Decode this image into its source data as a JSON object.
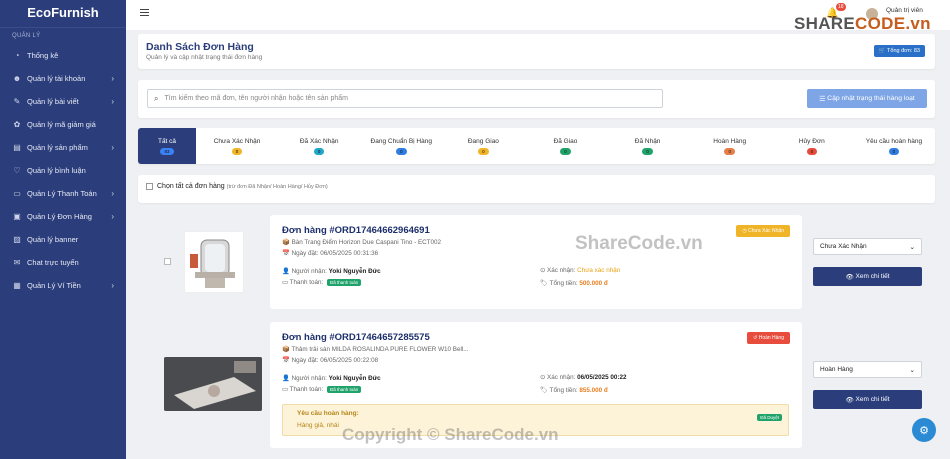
{
  "sidebar": {
    "logo": "EcoFurnish",
    "section_label": "QUẢN LÝ",
    "items": [
      {
        "label": "Thống kê",
        "icon": "gauge-icon",
        "glyph": "◔",
        "chev": ""
      },
      {
        "label": "Quản lý tài khoản",
        "icon": "user-icon",
        "glyph": "☻",
        "chev": "›"
      },
      {
        "label": "Quản lý bài viết",
        "icon": "document-icon",
        "glyph": "✎",
        "chev": "›"
      },
      {
        "label": "Quản lý mã giảm giá",
        "icon": "gift-icon",
        "glyph": "✿",
        "chev": ""
      },
      {
        "label": "Quản lý sản phẩm",
        "icon": "box-icon",
        "glyph": "▤",
        "chev": "›"
      },
      {
        "label": "Quản lý bình luận",
        "icon": "heart-icon",
        "glyph": "♡",
        "chev": ""
      },
      {
        "label": "Quản Lý Thanh Toán",
        "icon": "card-icon",
        "glyph": "▭",
        "chev": "›"
      },
      {
        "label": "Quản Lý Đơn Hàng",
        "icon": "clipboard-icon",
        "glyph": "▣",
        "chev": "›"
      },
      {
        "label": "Quản lý banner",
        "icon": "image-icon",
        "glyph": "▨",
        "chev": ""
      },
      {
        "label": "Chat trực tuyến",
        "icon": "chat-icon",
        "glyph": "✉",
        "chev": ""
      },
      {
        "label": "Quản Lý Ví Tiền",
        "icon": "wallet-icon",
        "glyph": "▦",
        "chev": "›"
      }
    ]
  },
  "topbar": {
    "user_name": "Quản trị viên",
    "notif_count": "18"
  },
  "page": {
    "title": "Danh Sách Đơn Hàng",
    "subtitle": "Quản lý và cập nhật trạng thái đơn hàng",
    "total": "Tổng đơn: 83"
  },
  "search": {
    "placeholder": "Tìm kiếm theo mã đơn, tên người nhận hoặc tên sản phẩm",
    "bulk_label": "Cập nhật trạng thái hàng loạt"
  },
  "tabs": [
    {
      "label": "Tất cả",
      "count": "83",
      "color": "#3b82f6"
    },
    {
      "label": "Chưa Xác Nhận",
      "count": "0",
      "color": "#f0b429"
    },
    {
      "label": "Đã Xác Nhận",
      "count": "0",
      "color": "#1fa7c7"
    },
    {
      "label": "Đang Chuẩn Bị Hàng",
      "count": "0",
      "color": "#2f7de1"
    },
    {
      "label": "Đang Giao",
      "count": "0",
      "color": "#f0b429"
    },
    {
      "label": "Đã Giao",
      "count": "0",
      "color": "#20a36b"
    },
    {
      "label": "Đã Nhận",
      "count": "0",
      "color": "#20a36b"
    },
    {
      "label": "Hoàn Hàng",
      "count": "0",
      "color": "#e67e4a"
    },
    {
      "label": "Hủy Đơn",
      "count": "0",
      "color": "#e74c3c"
    },
    {
      "label": "Yêu cầu hoàn hàng",
      "count": "0",
      "color": "#2f7de1"
    }
  ],
  "select_all": {
    "label": "Chọn tất cả đơn hàng",
    "note": "(trừ đơn Đã Nhận/ Hoàn Hàng/ Hủy Đơn)"
  },
  "orders": [
    {
      "title": "Đơn hàng #ORD17464662964691",
      "product": "Bàn Trang Điểm Horizon Due Caspani Tino - ECT002",
      "date": "Ngày đặt: 06/05/2025 00:31:36",
      "recipient_label": "Người nhận:",
      "recipient": "Yoki Nguyễn Đức",
      "confirm_label": "Xác nhận:",
      "confirm": "Chưa xác nhận",
      "confirm_color": "#e8a317",
      "payment_label": "Thanh toán:",
      "payment": "Đã thanh toán",
      "total_label": "Tổng tiền:",
      "total": "500.000 đ",
      "status": "Chưa Xác Nhận",
      "status_color": "#f0b429",
      "dropdown": "Chưa Xác Nhận",
      "view_label": "Xem chi tiết"
    },
    {
      "title": "Đơn hàng #ORD17464657285575",
      "product": "Thảm trải sàn MILDA ROSALINDA PURE FLOWER W10 Bell...",
      "date": "Ngày đặt: 06/05/2025 00:22:08",
      "recipient_label": "Người nhận:",
      "recipient": "Yoki Nguyễn Đức",
      "confirm_label": "Xác nhận:",
      "confirm": "06/05/2025 00:22",
      "confirm_color": "#222222",
      "payment_label": "Thanh toán:",
      "payment": "Đã thanh toán",
      "total_label": "Tổng tiền:",
      "total": "855.000 đ",
      "status": "Hoàn Hàng",
      "status_color": "#e74c3c",
      "dropdown": "Hoàn Hàng",
      "view_label": "Xem chi tiết",
      "return_title": "Yêu cầu hoàn hàng:",
      "return_reason": "Hàng giả, nhái",
      "return_badge": "Đã Duyệt"
    }
  ],
  "watermarks": {
    "brand1": "SHARE",
    "brand2": "CODE.vn",
    "center": "ShareCode.vn",
    "bottom": "Copyright © ShareCode.vn"
  }
}
